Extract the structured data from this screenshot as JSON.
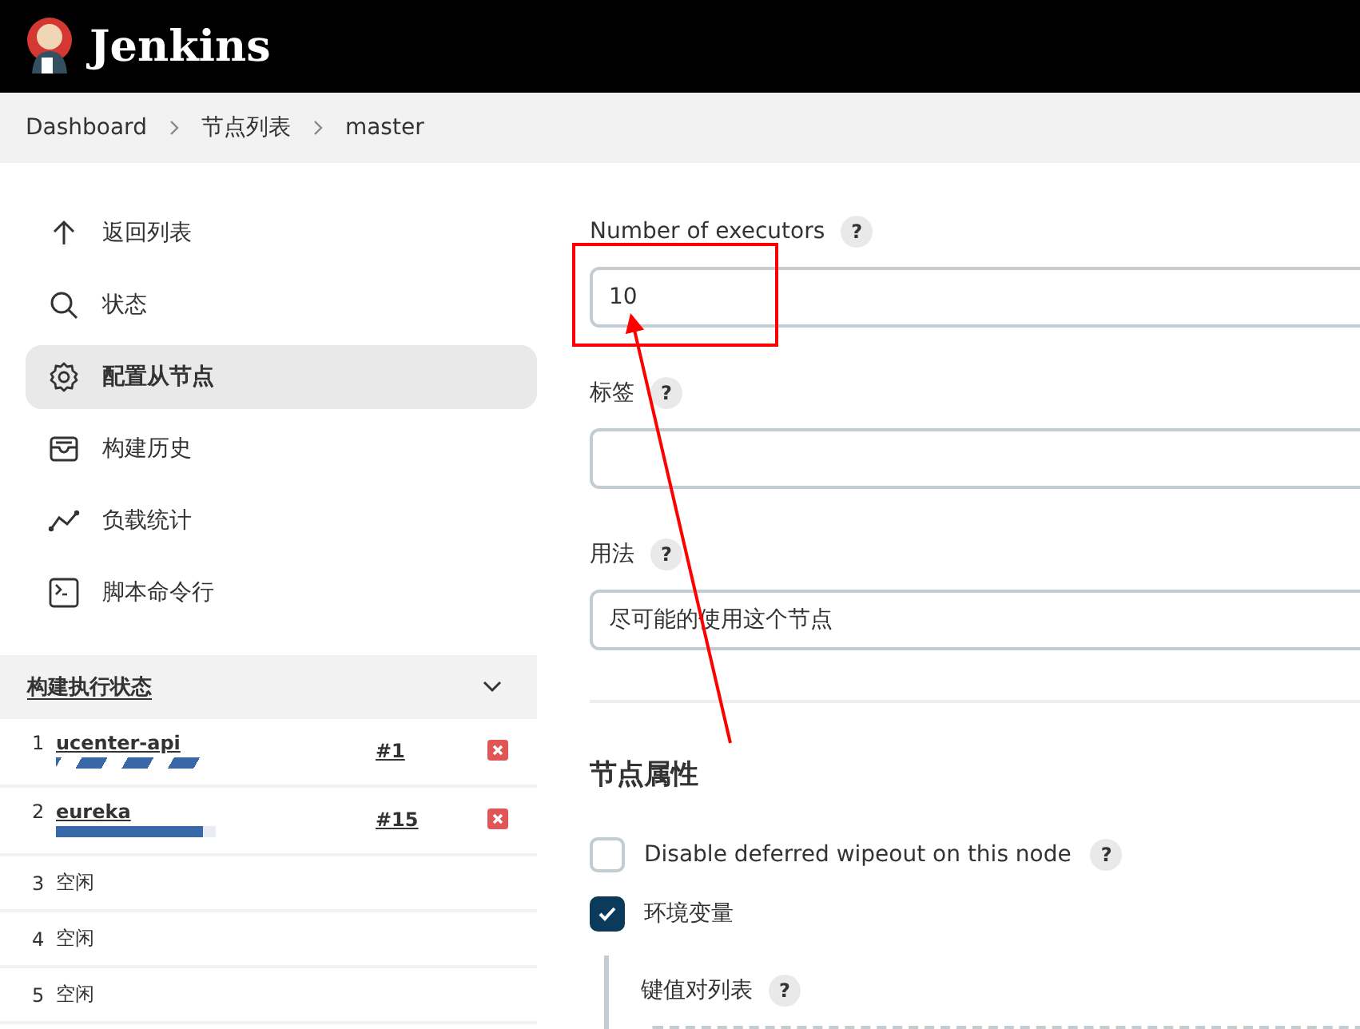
{
  "header": {
    "title": "Jenkins"
  },
  "breadcrumbs": [
    "Dashboard",
    "节点列表",
    "master"
  ],
  "sidebar": {
    "items": [
      {
        "label": "返回列表",
        "selected": false
      },
      {
        "label": "状态",
        "selected": false
      },
      {
        "label": "配置从节点",
        "selected": true
      },
      {
        "label": "构建历史",
        "selected": false
      },
      {
        "label": "负载统计",
        "selected": false
      },
      {
        "label": "脚本命令行",
        "selected": false
      }
    ]
  },
  "executors": {
    "title": "构建执行状态",
    "expanded": true,
    "rows": [
      {
        "number": "1",
        "kind": "indeterminate",
        "job": "ucenter-api",
        "build": "#1",
        "level": 0.93
      },
      {
        "number": "2",
        "kind": "progress",
        "job": "eureka",
        "build": "#15",
        "level": 0.92
      },
      {
        "number": "3",
        "kind": "idle",
        "status": "空闲"
      },
      {
        "number": "4",
        "kind": "idle",
        "status": "空闲"
      },
      {
        "number": "5",
        "kind": "idle",
        "status": "空闲"
      }
    ]
  },
  "form": {
    "fields": [
      {
        "label": "Number of executors",
        "help": "?",
        "value": "10"
      },
      {
        "label": "标签",
        "help": "?"
      },
      {
        "label": "用法",
        "help": "?",
        "value": "尽可能的使用这个节点"
      }
    ],
    "section_title": "节点属性",
    "checkboxes": [
      {
        "label": "Disable deferred wipeout on this node",
        "help": "?",
        "checked": false
      },
      {
        "label": "环境变量",
        "checked": true
      }
    ],
    "nested": {
      "label": "键值对列表",
      "help": "?"
    }
  }
}
